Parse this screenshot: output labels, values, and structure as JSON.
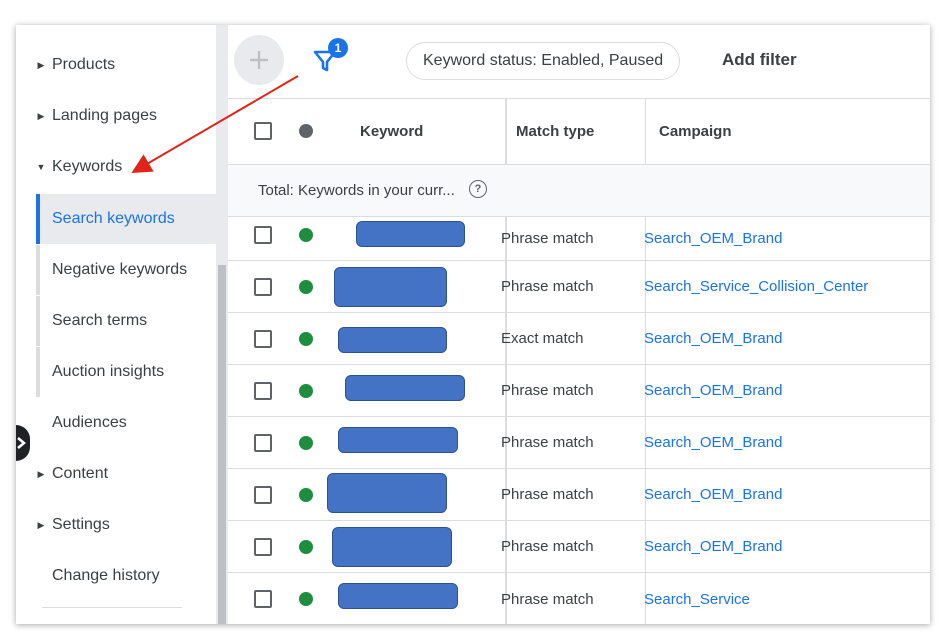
{
  "sidebar": {
    "items": [
      {
        "label": "Products",
        "arrow": "▶"
      },
      {
        "label": "Landing pages",
        "arrow": "▶"
      },
      {
        "label": "Keywords",
        "arrow": "▼"
      },
      {
        "label": "Audiences"
      },
      {
        "label": "Content",
        "arrow": "▶"
      },
      {
        "label": "Settings",
        "arrow": "▶"
      },
      {
        "label": "Change history"
      }
    ],
    "subitems": [
      {
        "label": "Search keywords"
      },
      {
        "label": "Negative keywords"
      },
      {
        "label": "Search terms"
      },
      {
        "label": "Auction insights"
      }
    ]
  },
  "toolbar": {
    "add_glyph": "+",
    "filter_badge": "1",
    "filter_chip": "Keyword status: Enabled, Paused",
    "add_filter": "Add filter"
  },
  "table": {
    "headers": {
      "keyword": "Keyword",
      "match_type": "Match type",
      "campaign": "Campaign"
    },
    "total_label": "Total: Keywords in your curr...",
    "help_glyph": "?",
    "rows": [
      {
        "match_type": "Phrase match",
        "campaign": "Search_OEM_Brand"
      },
      {
        "match_type": "Phrase match",
        "campaign": "Search_Service_Collision_Center"
      },
      {
        "match_type": "Exact match",
        "campaign": "Search_OEM_Brand"
      },
      {
        "match_type": "Phrase match",
        "campaign": "Search_OEM_Brand"
      },
      {
        "match_type": "Phrase match",
        "campaign": "Search_OEM_Brand"
      },
      {
        "match_type": "Phrase match",
        "campaign": "Search_OEM_Brand"
      },
      {
        "match_type": "Phrase match",
        "campaign": "Search_OEM_Brand"
      },
      {
        "match_type": "Phrase match",
        "campaign": "Search_Service"
      }
    ]
  },
  "colors": {
    "accent": "#1a73e8",
    "enabled_dot": "#1e8e3e",
    "status_header_dot": "#5f6368",
    "redaction": "#4472c4",
    "annotation_arrow": "#e0241b"
  },
  "icons": {
    "add": "add-icon",
    "filter": "filter-icon",
    "help": "help-icon",
    "collapse": "chevron-right-icon"
  }
}
